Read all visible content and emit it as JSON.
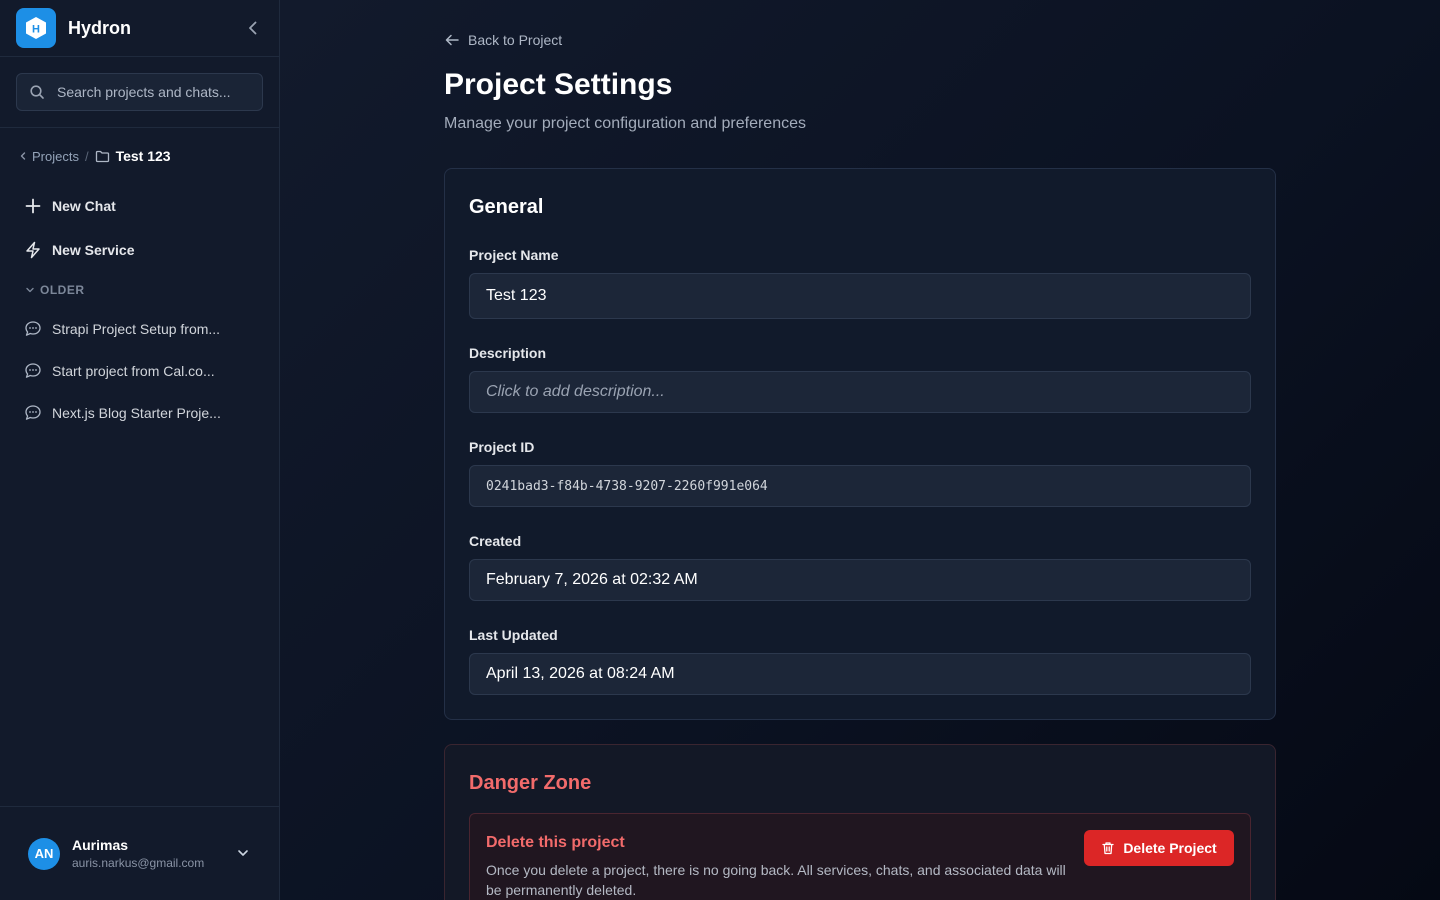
{
  "sidebar": {
    "brand": "Hydron",
    "search": {
      "placeholder": "Search projects and chats..."
    },
    "breadcrumb": {
      "parent": "Projects",
      "separator": "/",
      "current": "Test 123"
    },
    "actions": [
      {
        "label": "New Chat",
        "icon": "plus-icon"
      },
      {
        "label": "New Service",
        "icon": "lightning-icon"
      }
    ],
    "group_label": "OLDER",
    "chats": [
      {
        "label": "Strapi Project Setup from..."
      },
      {
        "label": "Start project from Cal.co..."
      },
      {
        "label": "Next.js Blog Starter Proje..."
      }
    ],
    "user": {
      "initials": "AN",
      "name": "Aurimas",
      "email": "auris.narkus@gmail.com"
    }
  },
  "main": {
    "back_label": "Back to Project",
    "title": "Project Settings",
    "subtitle": "Manage your project configuration and preferences",
    "general": {
      "heading": "General",
      "project_name_label": "Project Name",
      "project_name": "Test 123",
      "description_label": "Description",
      "description_placeholder": "Click to add description...",
      "project_id_label": "Project ID",
      "project_id": "0241bad3-f84b-4738-9207-2260f991e064",
      "created_label": "Created",
      "created": "February 7, 2026 at 02:32 AM",
      "updated_label": "Last Updated",
      "updated": "April 13, 2026 at 08:24 AM"
    },
    "danger": {
      "heading": "Danger Zone",
      "title": "Delete this project",
      "description": "Once you delete a project, there is no going back. All services, chats, and associated data will be permanently deleted.",
      "button_label": "Delete Project"
    }
  },
  "colors": {
    "accent": "#1d8fe6",
    "danger": "#dc2626",
    "danger_text": "#f26b6b",
    "background": "#0b1120",
    "sidebar": "#121a2b"
  }
}
